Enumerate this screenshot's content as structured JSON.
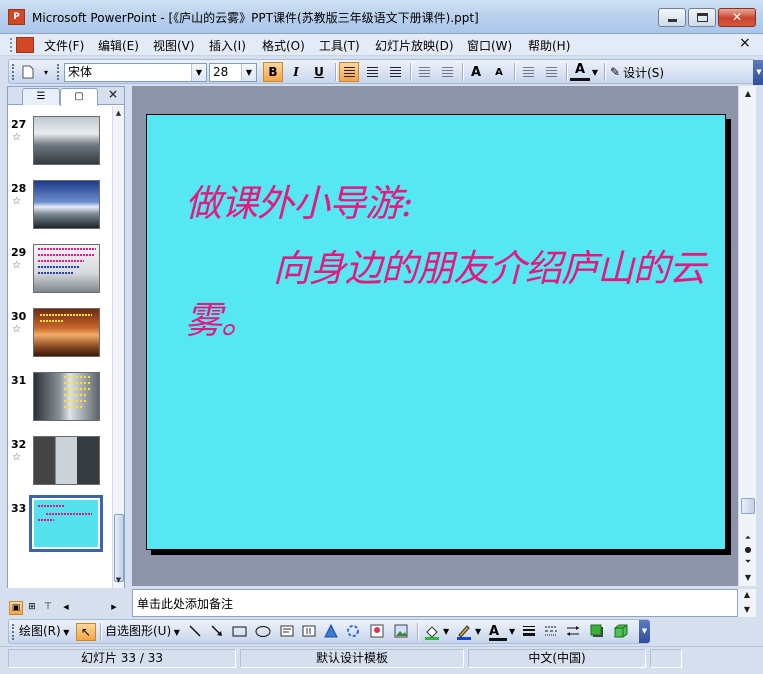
{
  "window": {
    "title": "Microsoft PowerPoint - [《庐山的云雾》PPT课件(苏教版三年级语文下册课件).ppt]",
    "app_icon": "P",
    "buttons": {
      "minimize": "minimize-icon",
      "maximize": "maximize-icon",
      "close": "✕"
    }
  },
  "menu": {
    "items": [
      "文件(F)",
      "编辑(E)",
      "视图(V)",
      "插入(I)",
      "格式(O)",
      "工具(T)",
      "幻灯片放映(D)",
      "窗口(W)",
      "帮助(H)"
    ],
    "close": "×"
  },
  "format_toolbar": {
    "font_name": "宋体",
    "font_size": "28",
    "bold": "B",
    "italic": "I",
    "underline": "U",
    "increase_font": "A",
    "decrease_font": "A",
    "font_color": "A",
    "design_label": "设计(S)"
  },
  "slide_panel": {
    "tabs": [
      "outline-icon",
      "slides-icon"
    ],
    "close": "×",
    "star": "☆",
    "slides": [
      {
        "number": "27",
        "thumb": "mountain-clouds"
      },
      {
        "number": "28",
        "thumb": "blue-sky-peaks"
      },
      {
        "number": "29",
        "thumb": "text-over-mist"
      },
      {
        "number": "30",
        "thumb": "sunset-clouds"
      },
      {
        "number": "31",
        "thumb": "waterfall"
      },
      {
        "number": "32",
        "thumb": "photo-collage"
      },
      {
        "number": "33",
        "thumb": "cyan-text"
      }
    ],
    "selected": "33"
  },
  "slide": {
    "background": "#55e7f2",
    "text_color": "#e6187e",
    "title": "做课外小导游:",
    "body": "向身边的朋友介绍庐山的云雾。"
  },
  "notes": {
    "placeholder": "单击此处添加备注"
  },
  "drawing_toolbar": {
    "draw_label": "绘图(R)",
    "autoshapes_label": "自选图形(U)",
    "font_color": "A"
  },
  "status": {
    "slide_info": "幻灯片 33 / 33",
    "template": "默认设计模板",
    "language": "中文(中国)"
  }
}
